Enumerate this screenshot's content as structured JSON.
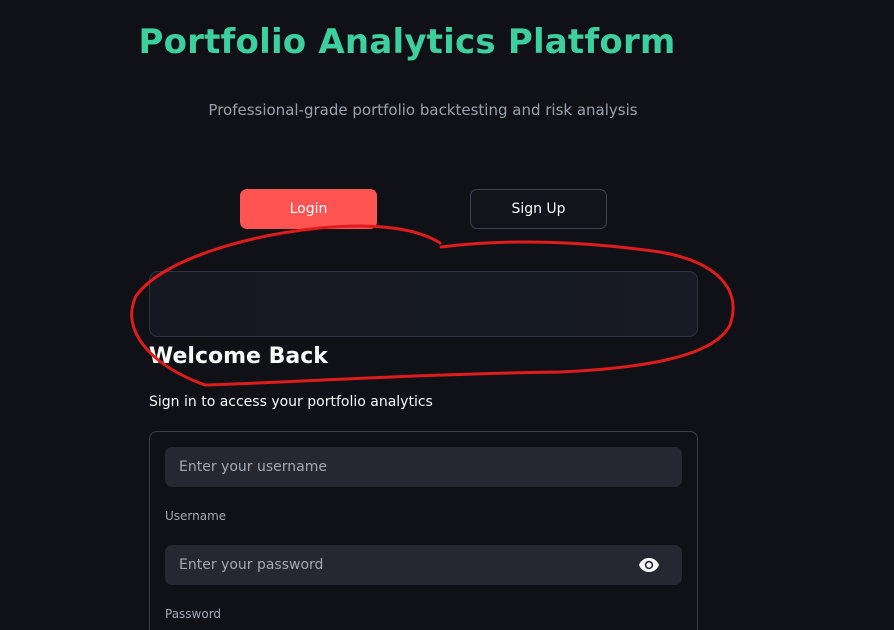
{
  "header": {
    "title": "Portfolio Analytics Platform",
    "subtitle": "Professional-grade portfolio backtesting and risk analysis"
  },
  "tabs": {
    "login_label": "Login",
    "signup_label": "Sign Up",
    "active": "Login"
  },
  "login": {
    "heading": "Welcome Back",
    "description": "Sign in to access your portfolio analytics",
    "username": {
      "placeholder": "Enter your username",
      "value": "",
      "label": "Username"
    },
    "password": {
      "placeholder": "Enter your password",
      "value": "",
      "label": "Password",
      "toggle_icon": "eye-icon"
    }
  },
  "colors": {
    "accent_title": "#3ecf9e",
    "primary_button": "#ff5452",
    "background": "#0f1117",
    "annotation_stroke": "#e01b1b"
  }
}
